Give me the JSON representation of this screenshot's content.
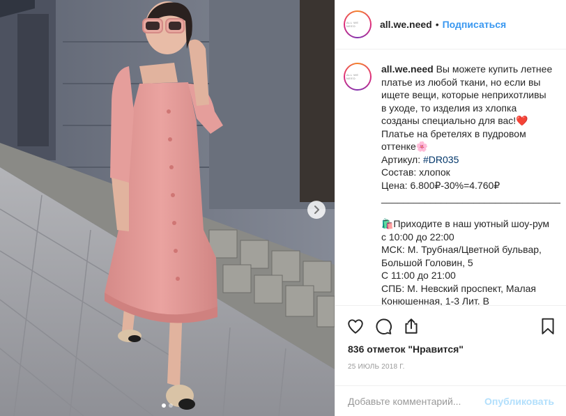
{
  "header": {
    "username": "all.we.need",
    "separator": "•",
    "follow_label": "Подписаться",
    "avatar_text": "ALL WE NEED"
  },
  "caption": {
    "username": "all.we.need",
    "lines": [
      "Вы можете купить летнее",
      "платье из любой ткани, но если вы",
      "ищете вещи, которые неприхотливы",
      "в уходе, то изделия из хлопка",
      "созданы специально для вас!❤️",
      "Платье на бретелях в пудровом",
      "оттенке🌸",
      "Артикул: ",
      "Состав: хлопок",
      "Цена: 6.800₽-30%=4.760₽",
      "_________________________________",
      "",
      "🛍️Приходите в наш уютный шоу-рум",
      "с 10:00 до 22:00",
      "МСК: М. Трубная/Цветной бульвар,",
      "Большой Головин, 5",
      "С 11:00 до 21:00",
      "СПБ: М. Невский проспект, Малая",
      "Конюшенная, 1-3 Лит. В"
    ],
    "hashtag": "#DR035"
  },
  "actions": {
    "like_icon": "heart-icon",
    "comment_icon": "comment-icon",
    "share_icon": "share-icon",
    "save_icon": "bookmark-icon",
    "likes_text": "836 отметок \"Нравится\"",
    "date": "25 июль 2018 г."
  },
  "comment": {
    "placeholder": "Добавьте комментарий...",
    "publish_label": "Опубликовать"
  },
  "carousel": {
    "next_icon": "chevron-right-icon",
    "total_slides": 2,
    "active_slide": 1
  },
  "colors": {
    "link_blue": "#3897f0",
    "hashtag_blue": "#003569",
    "publish_disabled": "#b2dffc",
    "dress_pink": "#e79a98",
    "border": "#efefef"
  }
}
